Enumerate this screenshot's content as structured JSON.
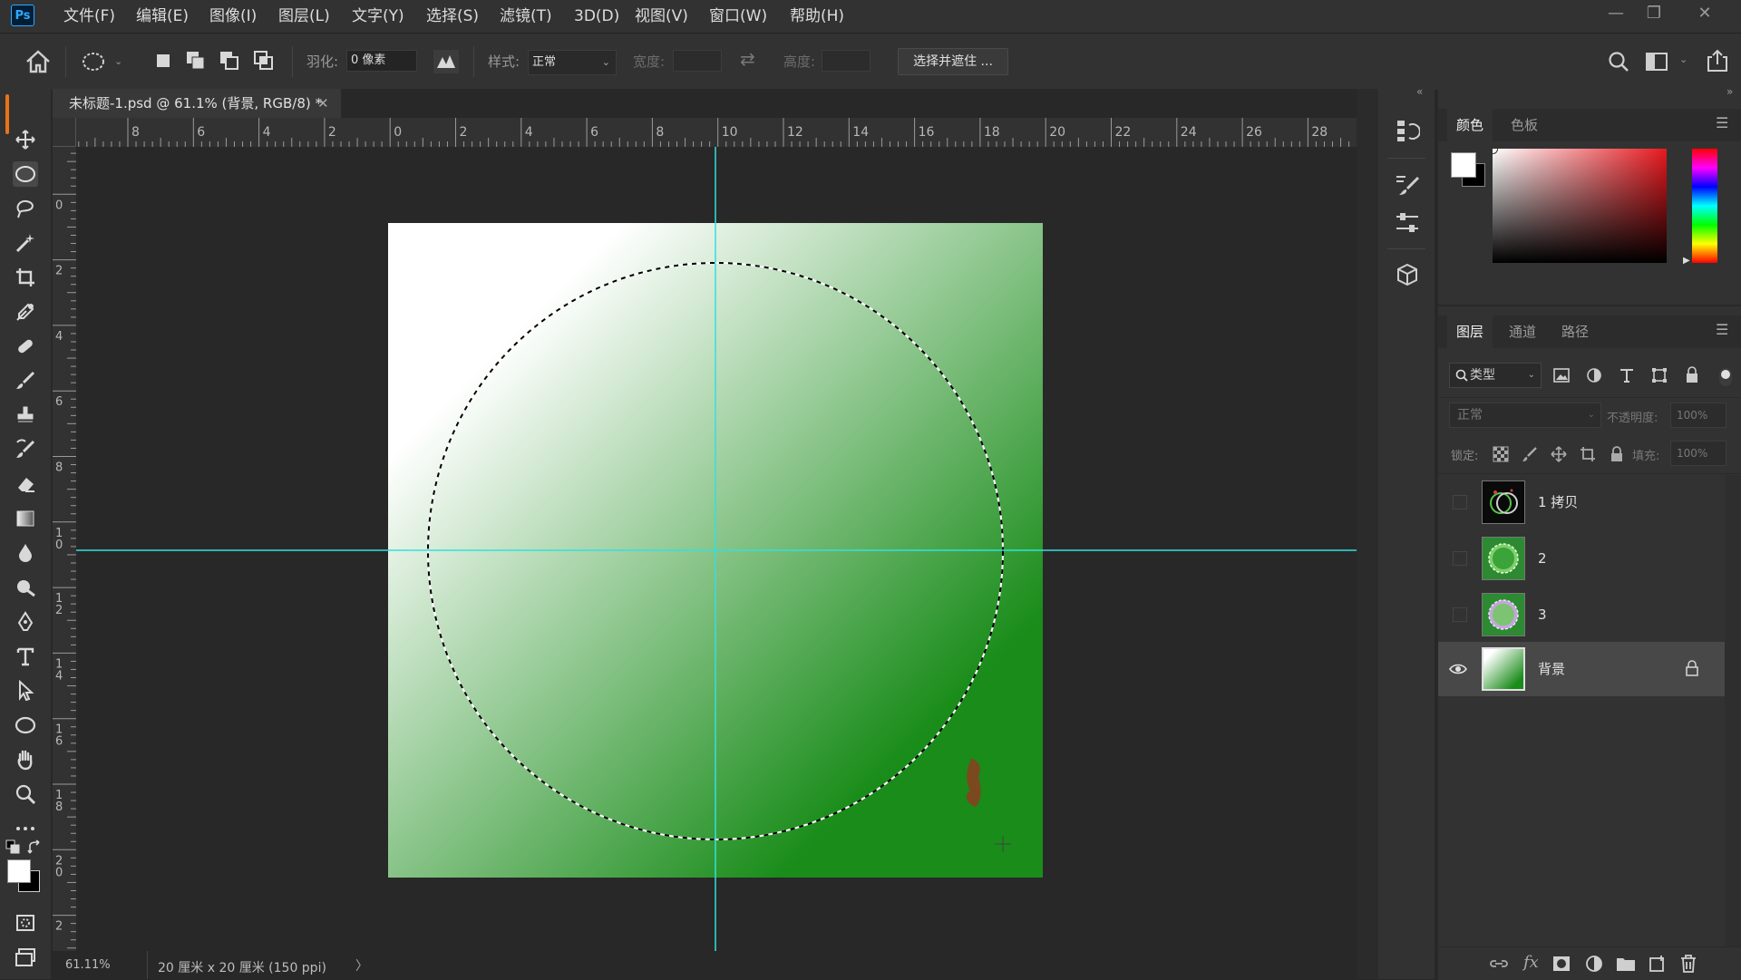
{
  "menu": {
    "items": [
      "文件(F)",
      "编辑(E)",
      "图像(I)",
      "图层(L)",
      "文字(Y)",
      "选择(S)",
      "滤镜(T)",
      "3D(D)",
      "视图(V)",
      "窗口(W)",
      "帮助(H)"
    ]
  },
  "app": {
    "logo": "Ps"
  },
  "options": {
    "feather_label": "羽化:",
    "feather_value": "0 像素",
    "style_label": "样式:",
    "style_value": "正常",
    "width_label": "宽度:",
    "height_label": "高度:",
    "select_mask_label": "选择并遮住 ..."
  },
  "document": {
    "tab_title": "未标题-1.psd @ 61.1% (背景, RGB/8) *",
    "zoom": "61.11%",
    "info": "20 厘米 x 20 厘米 (150 ppi)"
  },
  "rulers": {
    "horizontal": [
      "8",
      "6",
      "4",
      "2",
      "0",
      "2",
      "4",
      "6",
      "8",
      "10",
      "12",
      "14",
      "16",
      "18",
      "20",
      "22",
      "24",
      "26",
      "28"
    ],
    "vertical": [
      "2",
      "0",
      "2",
      "4",
      "6",
      "8",
      "10",
      "12",
      "14",
      "16",
      "18",
      "20",
      "2"
    ]
  },
  "color_panel": {
    "tabs": [
      "颜色",
      "色板"
    ],
    "foreground": "#ffffff",
    "background": "#000000",
    "hue_color": "#e8191f"
  },
  "layers_panel": {
    "tabs": [
      "图层",
      "通道",
      "路径"
    ],
    "filter_label": "类型",
    "blend_mode": "正常",
    "opacity_label": "不透明度:",
    "opacity_value": "100%",
    "lock_label": "锁定:",
    "fill_label": "填充:",
    "fill_value": "100%",
    "layers": [
      {
        "name": "1 拷贝",
        "visible": false
      },
      {
        "name": "2",
        "visible": false
      },
      {
        "name": "3",
        "visible": false
      },
      {
        "name": "背景",
        "visible": true,
        "locked": true,
        "selected": true
      }
    ]
  },
  "colors": {
    "guide": "#33e0e0",
    "gradient_start": "#ffffff",
    "gradient_end": "#198c19",
    "accent": "#31a8ff"
  }
}
